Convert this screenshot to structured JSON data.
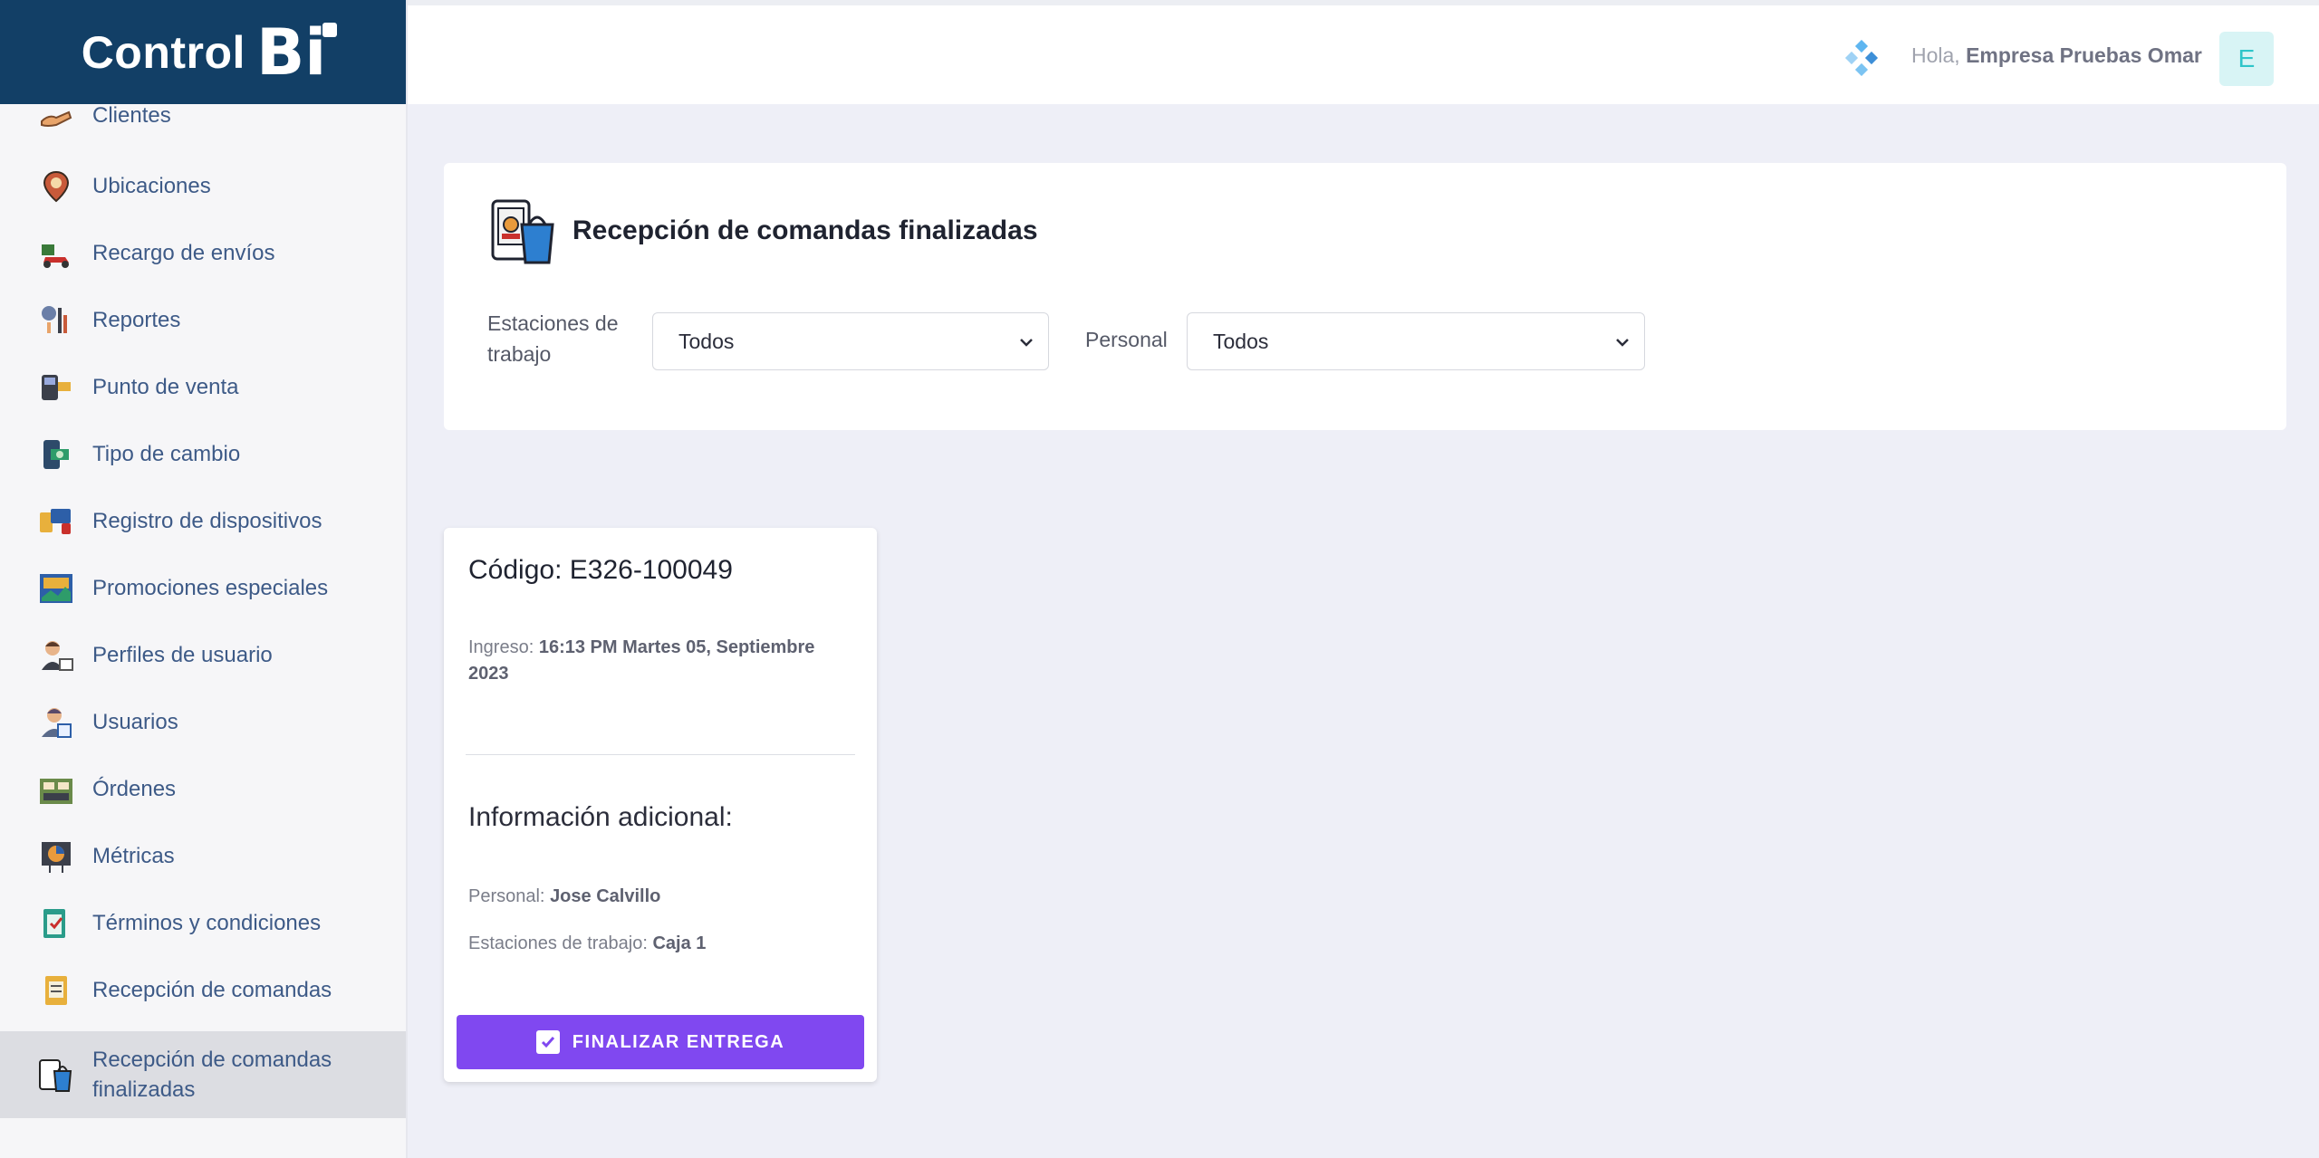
{
  "brand": {
    "text": "Control",
    "bi": "Bi"
  },
  "header": {
    "greeting_prefix": "Hola,",
    "user_name": "Empresa Pruebas Omar",
    "avatar_initial": "E"
  },
  "sidebar": {
    "items": [
      {
        "label": "Clientes",
        "icon": "handshake-icon",
        "color": "#e8a46a"
      },
      {
        "label": "Ubicaciones",
        "icon": "map-pin-icon",
        "color": "#c85a3a"
      },
      {
        "label": "Recargo de envíos",
        "icon": "delivery-scooter-icon",
        "color": "#c9302c"
      },
      {
        "label": "Reportes",
        "icon": "report-chart-icon",
        "color": "#6b7fa8"
      },
      {
        "label": "Punto de venta",
        "icon": "pos-terminal-icon",
        "color": "#3b3f4a"
      },
      {
        "label": "Tipo de cambio",
        "icon": "currency-exchange-icon",
        "color": "#2e9c6a"
      },
      {
        "label": "Registro de dispositivos",
        "icon": "devices-icon",
        "color": "#e8b03c"
      },
      {
        "label": "Promociones especiales",
        "icon": "promo-billboard-icon",
        "color": "#2d5fa8"
      },
      {
        "label": "Perfiles de usuario",
        "icon": "user-profile-icon",
        "color": "#8a5a3c"
      },
      {
        "label": "Usuarios",
        "icon": "users-icon",
        "color": "#5a6a8a"
      },
      {
        "label": "Órdenes",
        "icon": "orders-board-icon",
        "color": "#6a8a4a"
      },
      {
        "label": "Métricas",
        "icon": "metrics-pie-icon",
        "color": "#e89a3c"
      },
      {
        "label": "Términos y condiciones",
        "icon": "clipboard-icon",
        "color": "#2a9c8a"
      },
      {
        "label": "Recepción de comandas",
        "icon": "order-ticket-icon",
        "color": "#e8b03c"
      },
      {
        "label": "Recepción de comandas finalizadas",
        "label_line1": "Recepción de comandas",
        "label_line2": "finalizadas",
        "icon": "shopping-bag-phone-icon",
        "color": "#2d7fd0",
        "active": true
      }
    ]
  },
  "filters": {
    "title": "Recepción de comandas finalizadas",
    "estaciones_label": "Estaciones de trabajo",
    "estaciones_value": "Todos",
    "personal_label": "Personal",
    "personal_value": "Todos"
  },
  "order": {
    "code_label": "Código:",
    "code_value": "E326-100049",
    "ingreso_label": "Ingreso:",
    "ingreso_value": "16:13 PM Martes 05, Septiembre 2023",
    "info_title": "Información adicional:",
    "personal_label": "Personal:",
    "personal_value": "Jose Calvillo",
    "estaciones_label": "Estaciones de trabajo:",
    "estaciones_value": "Caja 1",
    "button_label": "FINALIZAR ENTREGA"
  },
  "colors": {
    "brand_bg": "#123f66",
    "accent": "#8048f0",
    "avatar_bg": "#d8f4f5",
    "avatar_fg": "#2ec5c9"
  }
}
